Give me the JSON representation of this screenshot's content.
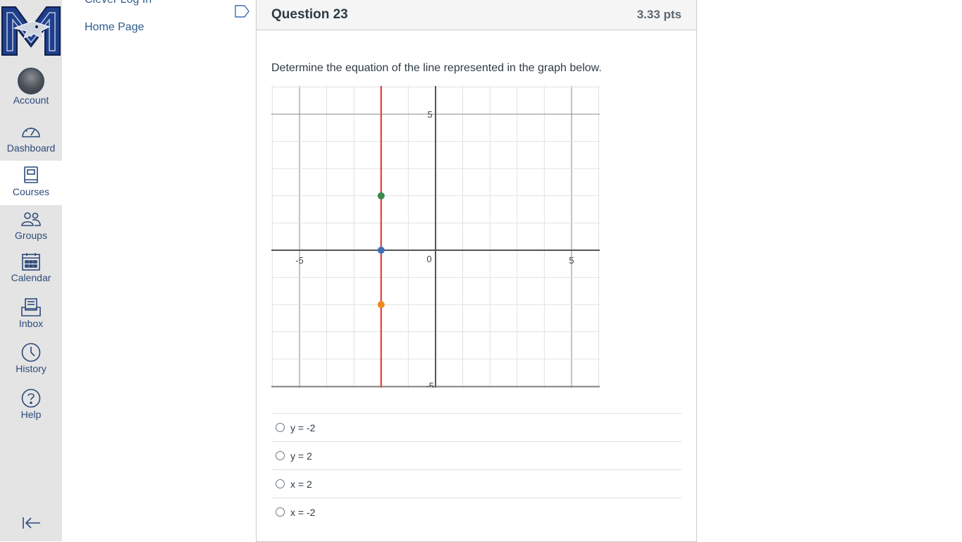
{
  "nav": {
    "items": [
      {
        "label": "Account",
        "icon": "avatar"
      },
      {
        "label": "Dashboard",
        "icon": "dashboard-icon"
      },
      {
        "label": "Courses",
        "icon": "courses-icon"
      },
      {
        "label": "Groups",
        "icon": "groups-icon"
      },
      {
        "label": "Calendar",
        "icon": "calendar-icon"
      },
      {
        "label": "Inbox",
        "icon": "inbox-icon"
      },
      {
        "label": "History",
        "icon": "history-icon"
      },
      {
        "label": "Help",
        "icon": "help-icon"
      }
    ],
    "active": "Courses",
    "accent": "#2d4a7a"
  },
  "course_nav": {
    "links": [
      "Clever Log In",
      "Home Page"
    ]
  },
  "question": {
    "title": "Question 23",
    "points": "3.33 pts",
    "text": "Determine the equation of the line represented in the graph below.",
    "answers": [
      "y = -2",
      "y = 2",
      "x = 2",
      "x = -2"
    ]
  },
  "graph": {
    "tick_labels": {
      "x_neg": "-5",
      "origin": "0",
      "x_pos": "5",
      "y_pos": "5",
      "y_neg": "-5"
    },
    "x_range": [
      -6,
      6
    ],
    "y_range": [
      -5,
      6
    ],
    "line": {
      "x": -2,
      "color": "#e05252"
    },
    "points": [
      {
        "x": -2,
        "y": 2,
        "color": "#3d8a4f"
      },
      {
        "x": -2,
        "y": 0,
        "color": "#3f6fb5"
      },
      {
        "x": -2,
        "y": -2,
        "color": "#f08a1c"
      }
    ]
  }
}
